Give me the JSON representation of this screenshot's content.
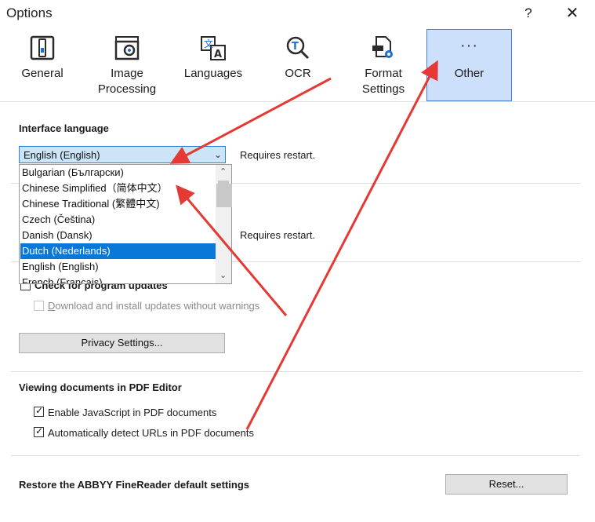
{
  "window": {
    "title": "Options",
    "help_label": "?",
    "close_label": "✕"
  },
  "tabs": [
    {
      "id": "general",
      "label": "General",
      "icon": "general-icon"
    },
    {
      "id": "image",
      "label_line1": "Image",
      "label_line2": "Processing",
      "icon": "image-processing-icon"
    },
    {
      "id": "languages",
      "label": "Languages",
      "icon": "languages-icon"
    },
    {
      "id": "ocr",
      "label": "OCR",
      "icon": "ocr-icon"
    },
    {
      "id": "format",
      "label_line1": "Format",
      "label_line2": "Settings",
      "icon": "format-settings-icon"
    },
    {
      "id": "other",
      "label": "Other",
      "icon": "more-icon",
      "glyph": "···",
      "selected": true
    }
  ],
  "interface_language": {
    "title": "Interface language",
    "selected": "English (English)",
    "requires_restart": "Requires restart.",
    "options": [
      "Bulgarian (Български)",
      "Chinese Simplified（简体中文）",
      "Chinese Traditional (繁體中文)",
      "Czech (Čeština)",
      "Danish (Dansk)",
      "Dutch (Nederlands)",
      "English (English)",
      "French (Français)"
    ],
    "highlighted_index": 5
  },
  "second_section": {
    "requires_restart": "Requires restart."
  },
  "updates": {
    "check_label_hidden": "Check for program updates",
    "download_label": "Download and install updates without warnings",
    "privacy_button": "Privacy Settings..."
  },
  "pdf_editor": {
    "title": "Viewing documents in PDF Editor",
    "enable_js": "Enable JavaScript in PDF documents",
    "detect_urls": "Automatically detect URLs in PDF documents"
  },
  "restore": {
    "title": "Restore the ABBYY FineReader default settings",
    "reset_button": "Reset..."
  },
  "colors": {
    "accent": "#0a78d7",
    "selected_tab": "#cce0fb",
    "annotation_arrow": "#e53935"
  }
}
